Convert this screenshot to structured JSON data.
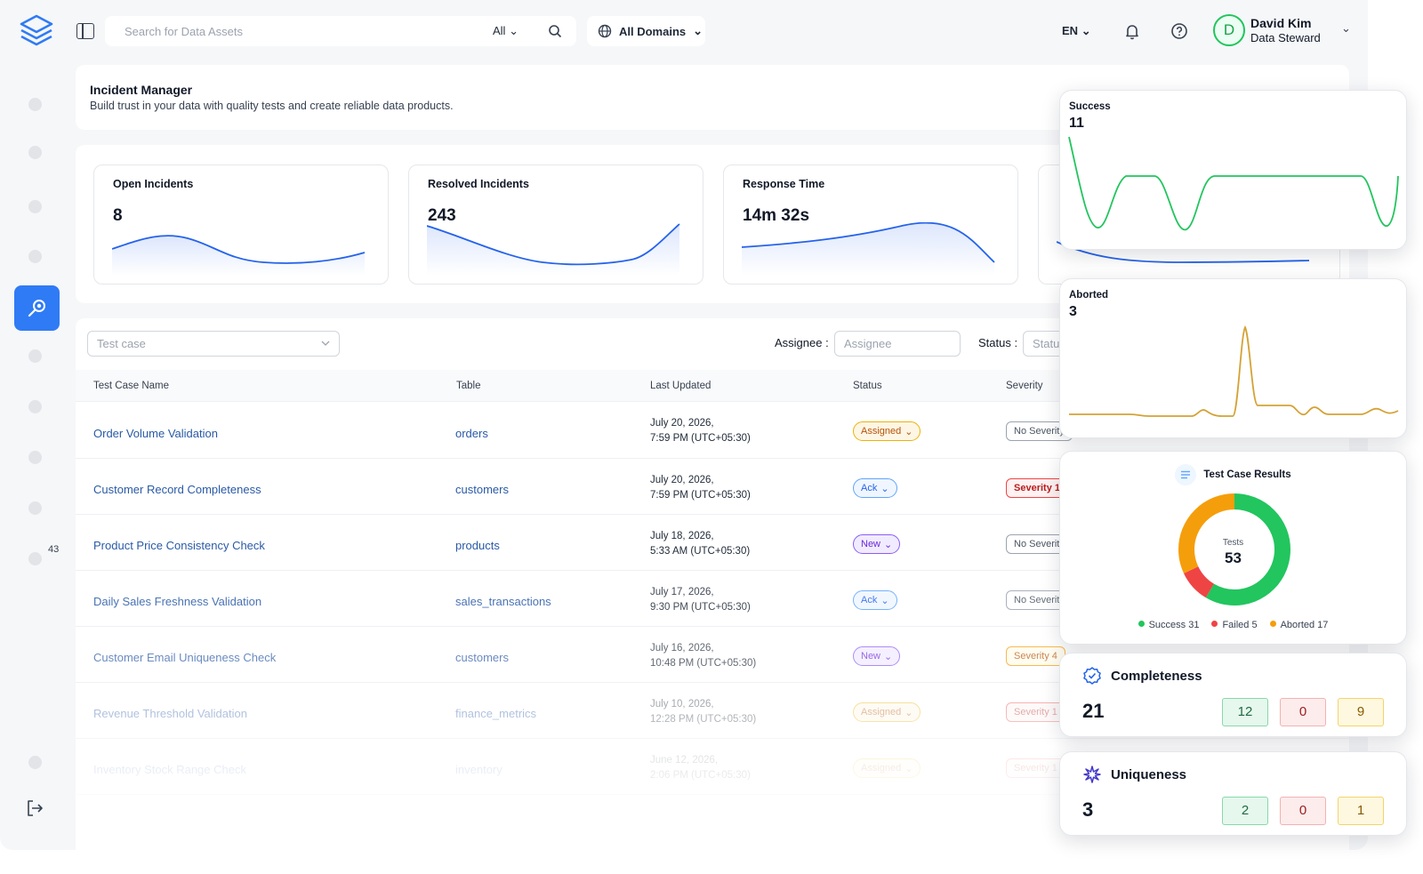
{
  "topbar": {
    "search_placeholder": "Search for Data Assets",
    "filter": "All",
    "domains": "All Domains",
    "language": "EN",
    "user_name": "David Kim",
    "user_role": "Data Steward",
    "user_initial": "D"
  },
  "sidebar": {
    "badge": "43"
  },
  "page": {
    "title": "Incident Manager",
    "subtitle": "Build trust in your data with quality tests and create reliable data products."
  },
  "stats": [
    {
      "label": "Open Incidents",
      "value": "8"
    },
    {
      "label": "Resolved Incidents",
      "value": "243"
    },
    {
      "label": "Response Time",
      "value": "14m 32s"
    }
  ],
  "filters": {
    "test_case_placeholder": "Test case",
    "assignee_label": "Assignee :",
    "assignee_placeholder": "Assignee",
    "status_label": "Status :",
    "status_placeholder": "Status"
  },
  "table": {
    "headers": [
      "Test Case Name",
      "Table",
      "Last Updated",
      "Status",
      "Severity"
    ],
    "rows": [
      {
        "name": "Order Volume Validation",
        "table": "orders",
        "date1": "July 20, 2026,",
        "date2": "7:59 PM (UTC+05:30)",
        "status": "Assigned",
        "severity": "No Severity"
      },
      {
        "name": "Customer Record Completeness",
        "table": "customers",
        "date1": "July 20, 2026,",
        "date2": "7:59 PM (UTC+05:30)",
        "status": "Ack",
        "severity": "Severity 1"
      },
      {
        "name": "Product Price Consistency Check",
        "table": "products",
        "date1": "July 18, 2026,",
        "date2": "5:33 AM (UTC+05:30)",
        "status": "New",
        "severity": "No Severity"
      },
      {
        "name": "Daily Sales Freshness Validation",
        "table": "sales_transactions",
        "date1": "July 17, 2026,",
        "date2": "9:30 PM (UTC+05:30)",
        "status": "Ack",
        "severity": "No Severity"
      },
      {
        "name": "Customer Email Uniqueness Check",
        "table": "customers",
        "date1": "July 16, 2026,",
        "date2": "10:48 PM (UTC+05:30)",
        "status": "New",
        "severity": "Severity 4"
      },
      {
        "name": "Revenue Threshold Validation",
        "table": "finance_metrics",
        "date1": "July 10, 2026,",
        "date2": "12:28 PM (UTC+05:30)",
        "status": "Assigned",
        "severity": "Severity 1"
      },
      {
        "name": "Inventory Stock Range Check",
        "table": "inventory",
        "date1": "June 12, 2026,",
        "date2": "2:06 PM (UTC+05:30)",
        "status": "Assigned",
        "severity": "Severity 1"
      }
    ]
  },
  "overlay": {
    "success": {
      "title": "Success",
      "value": "11"
    },
    "aborted": {
      "title": "Aborted",
      "value": "3"
    },
    "results": {
      "title": "Test Case Results",
      "center_label": "Tests",
      "center_value": "53",
      "legend": [
        "Success 31",
        "Failed 5",
        "Aborted 17"
      ]
    },
    "completeness": {
      "title": "Completeness",
      "total": "21",
      "success": "12",
      "failed": "0",
      "aborted": "9"
    },
    "uniqueness": {
      "title": "Uniqueness",
      "total": "3",
      "success": "2",
      "failed": "0",
      "aborted": "1"
    }
  },
  "colors": {
    "accent": "#2f7bf5",
    "success": "#22c55e",
    "failed": "#ef4444",
    "aborted": "#f59e0b",
    "link": "#2a5aa6"
  },
  "chart_data": [
    {
      "type": "pie",
      "categories": [
        "Success",
        "Failed",
        "Aborted"
      ],
      "values": [
        31,
        5,
        17
      ]
    }
  ]
}
